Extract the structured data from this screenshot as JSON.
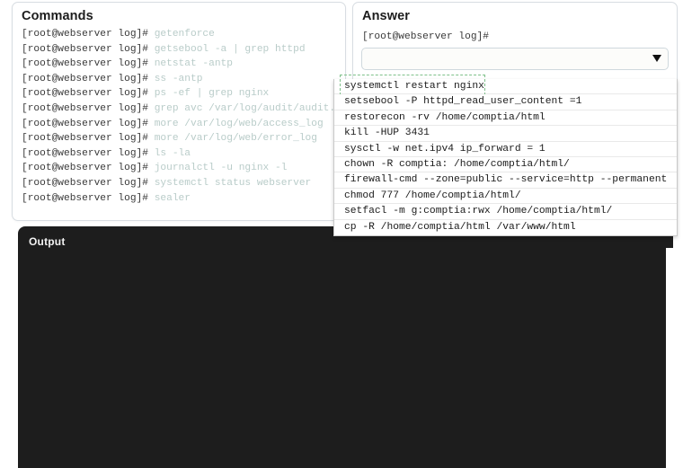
{
  "commands_panel": {
    "title": "Commands",
    "prompt": "[root@webserver log]# ",
    "lines": [
      "getenforce",
      "getsebool -a | grep httpd",
      "netstat -antp",
      "ss -antp",
      "ps -ef | grep nginx",
      "grep avc /var/log/audit/audit.log",
      "more /var/log/web/access_log",
      "more /var/log/web/error_log",
      "ls -la",
      "journalctl -u nginx -l",
      "systemctl status webserver",
      "sealer"
    ]
  },
  "answer_panel": {
    "title": "Answer",
    "prompt": "[root@webserver log]#",
    "select": {
      "value": "",
      "placeholder": "",
      "arrow_icon": "chevron-down-icon"
    }
  },
  "dropdown": {
    "focused_index": 0,
    "options": [
      "systemctl restart nginx",
      "setsebool -P httpd_read_user_content =1",
      "restorecon -rv /home/comptia/html",
      "kill -HUP 3431",
      "sysctl -w net.ipv4 ip_forward = 1",
      "chown -R comptia: /home/comptia/html/",
      "firewall-cmd --zone=public --service=http --permanent",
      "chmod 777 /home/comptia/html/",
      "setfacl -m g:comptia:rwx /home/comptia/html/",
      "cp -R /home/comptia/html /var/www/html"
    ]
  },
  "output_panel": {
    "title": "Output",
    "content": ""
  },
  "colors": {
    "command_text": "#b9ccc9",
    "prompt_text": "#3a3a3a",
    "focus_outline": "#7ec08a",
    "output_bg": "#1d1d1d",
    "card_border": "#d8dde2"
  }
}
